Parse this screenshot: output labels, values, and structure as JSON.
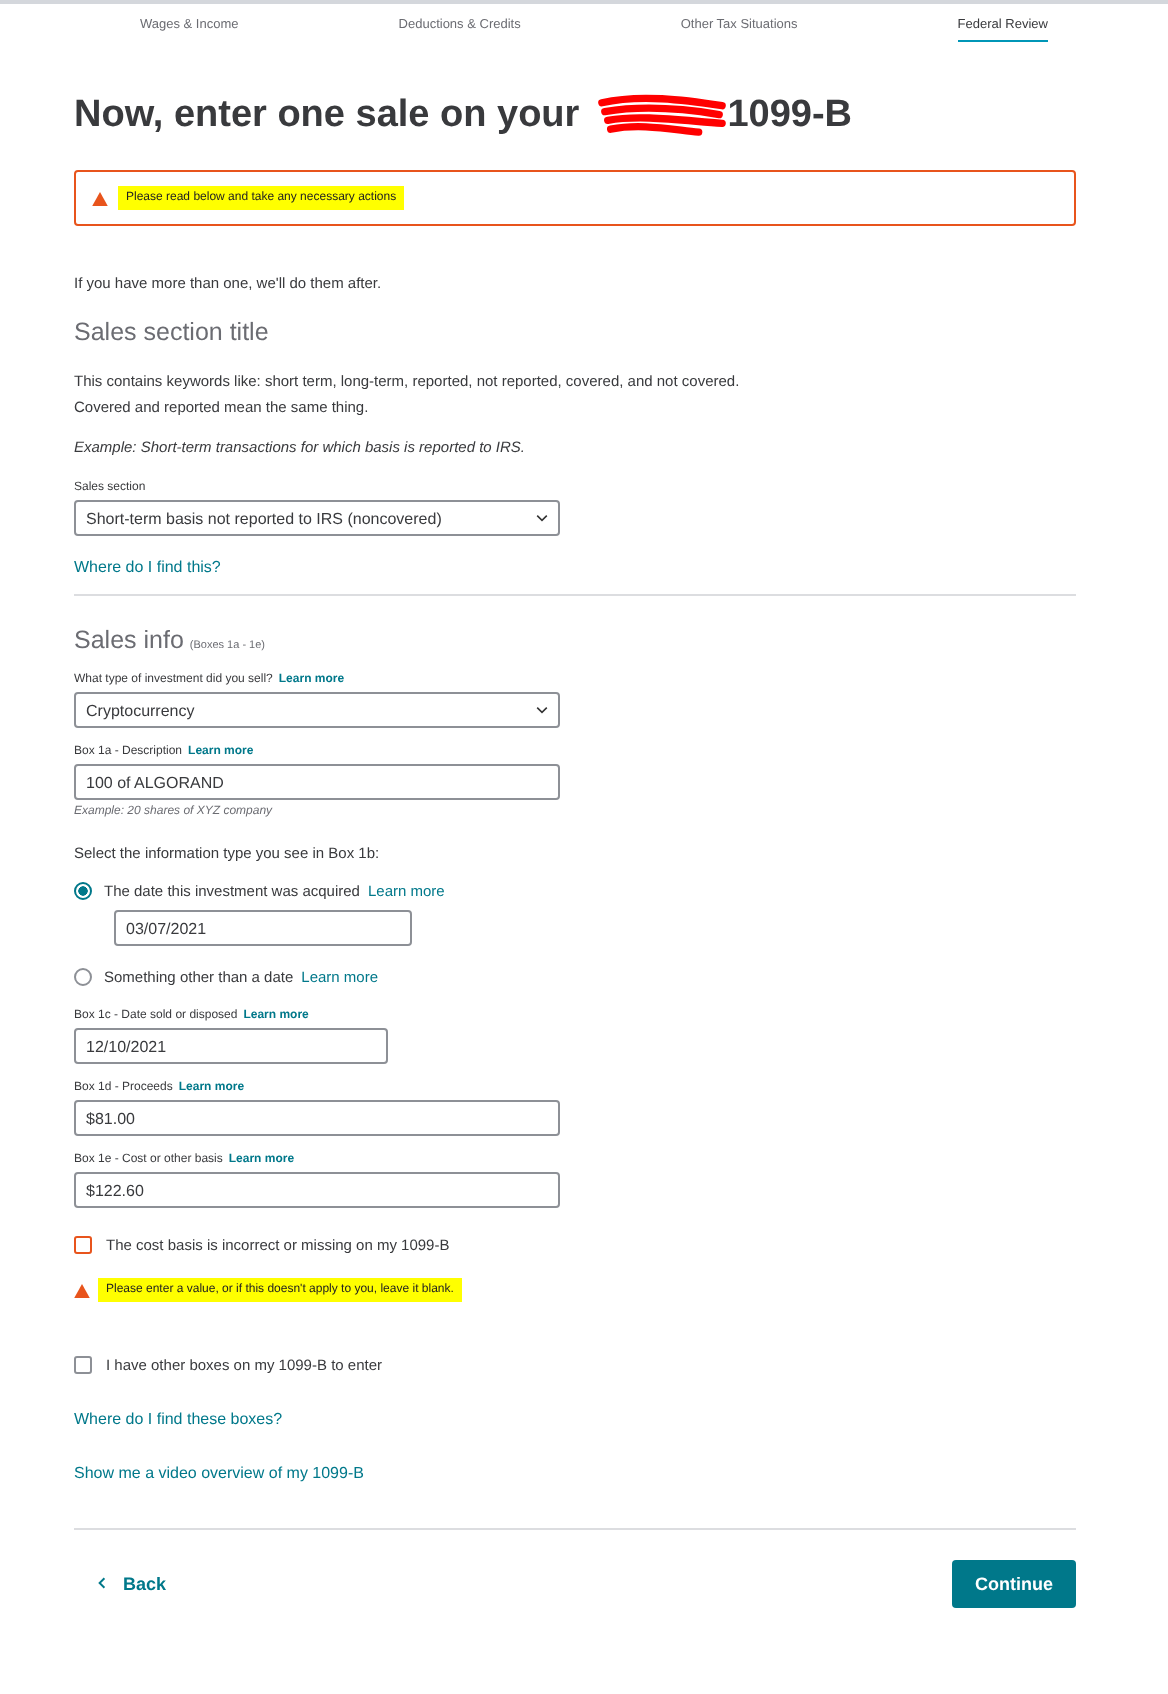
{
  "tabs": [
    {
      "label": "Wages & Income",
      "selected": false
    },
    {
      "label": "Deductions & Credits",
      "selected": false
    },
    {
      "label": "Other Tax Situations",
      "selected": false
    },
    {
      "label": "Federal Review",
      "selected": true
    }
  ],
  "heading": {
    "before": "Now, enter one sale on your",
    "after": "1099-B",
    "redacted": true
  },
  "alert": {
    "text": "Please read below and take any necessary actions",
    "highlighted": true
  },
  "intro": "If you have more than one, we'll do them after.",
  "sales_section": {
    "title": "Sales section title",
    "description": [
      "This contains keywords like: short term, long-term, reported, not reported, covered, and not covered.",
      "Covered and reported mean the same thing."
    ],
    "example": "Example: Short-term transactions for which basis is reported to IRS.",
    "field_label": "Sales section",
    "field_value": "Short-term basis not reported to IRS (noncovered)",
    "help_link": "Where do I find this?"
  },
  "sales_info": {
    "title": "Sales info",
    "subtitle": "(Boxes 1a - 1e)",
    "items": [
      {
        "kind": "select",
        "label": "What type of investment did you sell?",
        "link": "Learn more",
        "value": "Cryptocurrency"
      },
      {
        "kind": "text",
        "label": "Box 1a - Description",
        "link": "Learn more",
        "value": "100 of ALGORAND",
        "hint": "Example: 20 shares of XYZ company"
      },
      {
        "kind": "radio_group",
        "label": "Select the information type you see in Box 1b:",
        "options": [
          {
            "label": "The date this investment was acquired",
            "link": "Learn more",
            "selected": true,
            "value": "03/07/2021"
          },
          {
            "label": "Something other than a date",
            "link": "Learn more",
            "selected": false
          }
        ]
      },
      {
        "kind": "date",
        "label": "Box 1c - Date sold or disposed",
        "link": "Learn more",
        "value": "12/10/2021"
      },
      {
        "kind": "text",
        "label": "Box 1d - Proceeds",
        "link": "Learn more",
        "value": "$81.00"
      },
      {
        "kind": "text",
        "label": "Box 1e - Cost or other basis",
        "link": "Learn more",
        "value": "$122.60"
      },
      {
        "kind": "checkbox",
        "label": "The cost basis is incorrect or missing on my 1099-B",
        "checked": false,
        "error": true
      },
      {
        "kind": "warning",
        "text": "Please enter a value, or if this doesn't apply to you, leave it blank.",
        "highlighted": true
      },
      {
        "kind": "checkbox",
        "label": "I have other boxes on my 1099-B to enter",
        "checked": false,
        "error": false
      },
      {
        "kind": "link",
        "text": "Where do I find these boxes?"
      },
      {
        "kind": "link",
        "text": "Show me a video overview of my 1099-B"
      }
    ]
  },
  "footer": {
    "back": "Back",
    "continue": "Continue"
  }
}
